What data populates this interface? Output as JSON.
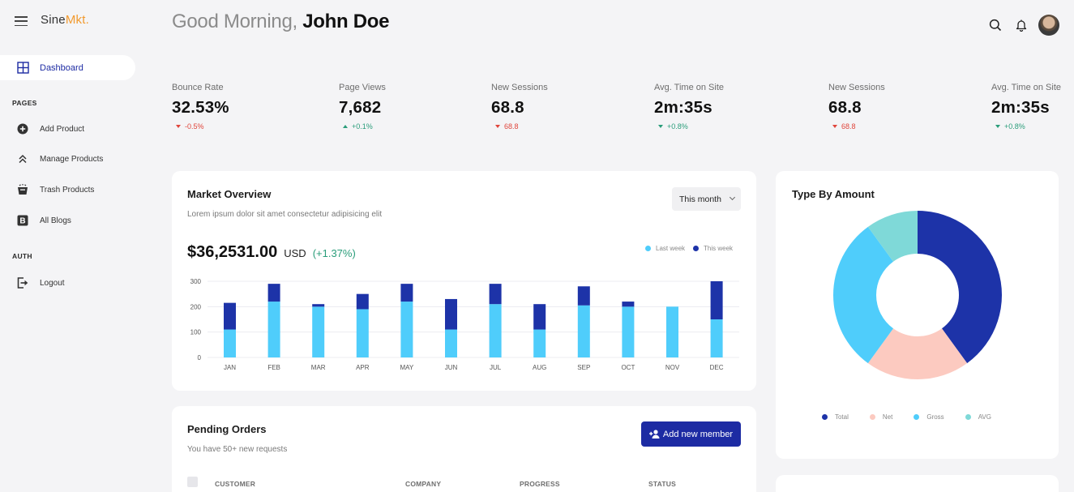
{
  "brand": {
    "name_main": "Sine",
    "name_accent": "Mkt."
  },
  "sidebar": {
    "active": {
      "label": "Dashboard"
    },
    "pages_label": "PAGES",
    "pages": [
      {
        "label": "Add Product",
        "icon": "plus-circle-icon"
      },
      {
        "label": "Manage Products",
        "icon": "double-chevron-up-icon"
      },
      {
        "label": "Trash Products",
        "icon": "trash-basket-icon"
      },
      {
        "label": "All Blogs",
        "icon": "blogger-icon"
      }
    ],
    "auth_label": "AUTH",
    "auth": [
      {
        "label": "Logout",
        "icon": "logout-icon"
      }
    ]
  },
  "header": {
    "greeting": "Good Morning,",
    "user_name": "John Doe"
  },
  "stats": [
    {
      "label": "Bounce Rate",
      "value": "32.53%",
      "change": "-0.5%",
      "trend": "down-red"
    },
    {
      "label": "Page Views",
      "value": "7,682",
      "change": "+0.1%",
      "trend": "up-green"
    },
    {
      "label": "New Sessions",
      "value": "68.8",
      "change": "68.8",
      "trend": "down-red"
    },
    {
      "label": "Avg. Time on Site",
      "value": "2m:35s",
      "change": "+0.8%",
      "trend": "down-green"
    },
    {
      "label": "New Sessions",
      "value": "68.8",
      "change": "68.8",
      "trend": "down-red"
    },
    {
      "label": "Avg. Time on Site",
      "value": "2m:35s",
      "change": "+0.8%",
      "trend": "down-green"
    }
  ],
  "market": {
    "title": "Market Overview",
    "subtitle": "Lorem ipsum dolor sit amet consectetur adipisicing elit",
    "dropdown": "This month",
    "amount": "$36,2531.00",
    "currency": "USD",
    "change": "(+1.37%)",
    "legend": [
      {
        "label": "Last week",
        "color": "#4fcdfb"
      },
      {
        "label": "This week",
        "color": "#1d33a8"
      }
    ]
  },
  "chart_data": [
    {
      "type": "bar",
      "stacked": true,
      "categories": [
        "JAN",
        "FEB",
        "MAR",
        "APR",
        "MAY",
        "JUN",
        "JUL",
        "AUG",
        "SEP",
        "OCT",
        "NOV",
        "DEC"
      ],
      "series": [
        {
          "name": "Last week",
          "color": "#4fcdfb",
          "values": [
            110,
            220,
            200,
            190,
            220,
            110,
            210,
            110,
            205,
            200,
            200,
            150
          ]
        },
        {
          "name": "This week",
          "color": "#1d33a8",
          "values": [
            105,
            70,
            10,
            60,
            70,
            120,
            80,
            100,
            75,
            20,
            0,
            150
          ]
        }
      ],
      "yticks": [
        0,
        100,
        200,
        300
      ],
      "ylim": [
        0,
        300
      ],
      "grid": true,
      "legend_position": "top-right"
    },
    {
      "type": "pie",
      "donut": true,
      "title": "Type By Amount",
      "labels": [
        "Total",
        "Net",
        "Gross",
        "AVG"
      ],
      "values": [
        40,
        20,
        30,
        10
      ],
      "colors": [
        "#1d33a8",
        "#fccac0",
        "#4fcdfb",
        "#7fd9d8"
      ],
      "legend_position": "bottom"
    }
  ],
  "pending": {
    "title": "Pending Orders",
    "subtitle": "You have 50+ new requests",
    "button": "Add new member",
    "columns": [
      "CUSTOMER",
      "COMPANY",
      "PROGRESS",
      "STATUS"
    ]
  }
}
